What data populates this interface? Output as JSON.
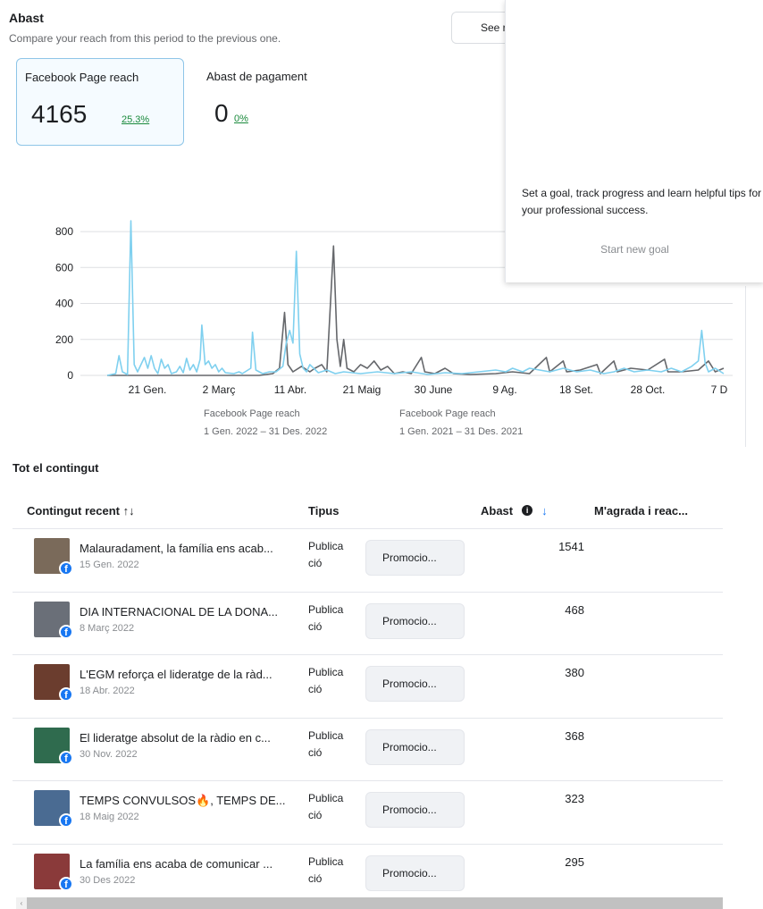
{
  "header": {
    "title": "Abast",
    "subtitle": "Compare your reach from this period to the previous one.",
    "see_more_label": "See r"
  },
  "metrics": [
    {
      "label": "Facebook Page reach",
      "value": "4165",
      "change": "25.3%"
    },
    {
      "label": "Abast de pagament",
      "value": "0",
      "change": "0%"
    }
  ],
  "goal_panel": {
    "text": "Set a goal, track progress and learn helpful tips for your professional success.",
    "button_label": "Start new goal"
  },
  "chart_data": {
    "type": "line",
    "x_tick_labels": [
      "21 Gen.",
      "2 Març",
      "11 Abr.",
      "21 Maig",
      "30 June",
      "9 Ag.",
      "18 Set.",
      "28 Oct.",
      "7 D"
    ],
    "y_tick_labels": [
      "0",
      "200",
      "400",
      "600",
      "800"
    ],
    "ylim": [
      0,
      860
    ],
    "x_range_days": [
      0,
      365
    ],
    "series": [
      {
        "name": "Facebook Page reach",
        "period": "1 Gen. 2022 – 31 Des. 2022",
        "color": "#7fd0ef",
        "points": [
          [
            0,
            0
          ],
          [
            5,
            10
          ],
          [
            7,
            110
          ],
          [
            9,
            20
          ],
          [
            12,
            5
          ],
          [
            14,
            860
          ],
          [
            16,
            60
          ],
          [
            18,
            20
          ],
          [
            20,
            60
          ],
          [
            22,
            100
          ],
          [
            24,
            40
          ],
          [
            26,
            110
          ],
          [
            28,
            40
          ],
          [
            30,
            10
          ],
          [
            32,
            90
          ],
          [
            34,
            40
          ],
          [
            36,
            60
          ],
          [
            38,
            10
          ],
          [
            41,
            20
          ],
          [
            43,
            50
          ],
          [
            45,
            15
          ],
          [
            47,
            95
          ],
          [
            49,
            30
          ],
          [
            51,
            60
          ],
          [
            53,
            20
          ],
          [
            55,
            90
          ],
          [
            56,
            280
          ],
          [
            58,
            60
          ],
          [
            60,
            80
          ],
          [
            62,
            40
          ],
          [
            64,
            60
          ],
          [
            66,
            20
          ],
          [
            68,
            40
          ],
          [
            70,
            15
          ],
          [
            75,
            10
          ],
          [
            78,
            20
          ],
          [
            80,
            10
          ],
          [
            85,
            40
          ],
          [
            86,
            240
          ],
          [
            88,
            30
          ],
          [
            92,
            10
          ],
          [
            96,
            20
          ],
          [
            100,
            20
          ],
          [
            104,
            50
          ],
          [
            106,
            180
          ],
          [
            108,
            250
          ],
          [
            110,
            180
          ],
          [
            112,
            690
          ],
          [
            114,
            120
          ],
          [
            116,
            40
          ],
          [
            118,
            20
          ],
          [
            120,
            60
          ],
          [
            125,
            15
          ],
          [
            130,
            30
          ],
          [
            135,
            10
          ],
          [
            140,
            20
          ],
          [
            150,
            10
          ],
          [
            160,
            20
          ],
          [
            170,
            10
          ],
          [
            180,
            20
          ],
          [
            190,
            5
          ],
          [
            200,
            15
          ],
          [
            210,
            10
          ],
          [
            220,
            20
          ],
          [
            230,
            30
          ],
          [
            236,
            20
          ],
          [
            240,
            40
          ],
          [
            246,
            20
          ],
          [
            250,
            40
          ],
          [
            256,
            30
          ],
          [
            262,
            20
          ],
          [
            270,
            40
          ],
          [
            278,
            20
          ],
          [
            286,
            30
          ],
          [
            294,
            10
          ],
          [
            300,
            20
          ],
          [
            306,
            40
          ],
          [
            312,
            20
          ],
          [
            320,
            30
          ],
          [
            328,
            20
          ],
          [
            334,
            40
          ],
          [
            340,
            20
          ],
          [
            346,
            50
          ],
          [
            350,
            80
          ],
          [
            352,
            250
          ],
          [
            354,
            70
          ],
          [
            356,
            20
          ],
          [
            360,
            40
          ],
          [
            365,
            10
          ]
        ]
      },
      {
        "name": "Facebook Page reach",
        "period": "1 Gen. 2021 – 31 Des. 2021",
        "color": "#65676b",
        "points": [
          [
            0,
            0
          ],
          [
            90,
            0
          ],
          [
            98,
            10
          ],
          [
            102,
            40
          ],
          [
            105,
            350
          ],
          [
            107,
            60
          ],
          [
            110,
            20
          ],
          [
            115,
            50
          ],
          [
            120,
            20
          ],
          [
            123,
            40
          ],
          [
            127,
            60
          ],
          [
            130,
            20
          ],
          [
            134,
            720
          ],
          [
            136,
            200
          ],
          [
            138,
            50
          ],
          [
            140,
            200
          ],
          [
            142,
            40
          ],
          [
            146,
            20
          ],
          [
            150,
            60
          ],
          [
            154,
            40
          ],
          [
            158,
            80
          ],
          [
            162,
            30
          ],
          [
            166,
            50
          ],
          [
            170,
            10
          ],
          [
            175,
            20
          ],
          [
            180,
            10
          ],
          [
            186,
            100
          ],
          [
            188,
            20
          ],
          [
            194,
            10
          ],
          [
            200,
            40
          ],
          [
            205,
            10
          ],
          [
            215,
            5
          ],
          [
            230,
            10
          ],
          [
            240,
            20
          ],
          [
            250,
            10
          ],
          [
            260,
            100
          ],
          [
            262,
            20
          ],
          [
            270,
            80
          ],
          [
            272,
            20
          ],
          [
            280,
            30
          ],
          [
            290,
            60
          ],
          [
            292,
            10
          ],
          [
            300,
            80
          ],
          [
            302,
            20
          ],
          [
            310,
            40
          ],
          [
            320,
            30
          ],
          [
            330,
            90
          ],
          [
            332,
            20
          ],
          [
            340,
            20
          ],
          [
            350,
            30
          ],
          [
            356,
            80
          ],
          [
            360,
            20
          ],
          [
            365,
            40
          ]
        ]
      }
    ]
  },
  "all_content": {
    "title": "Tot el contingut",
    "columns": [
      "Contingut recent ↑↓",
      "Tipus",
      "Abast",
      "M'agrada i reac..."
    ],
    "promote_label": "Promocio...",
    "rows": [
      {
        "title": "Malauradament, la família ens acab...",
        "date": "15 Gen. 2022",
        "type": "Publica ció",
        "reach": "1541"
      },
      {
        "title": "DIA INTERNACIONAL DE LA DONA...",
        "date": "8 Març 2022",
        "type": "Publica ció",
        "reach": "468"
      },
      {
        "title": "L'EGM reforça el lideratge de la ràd...",
        "date": "18 Abr. 2022",
        "type": "Publica ció",
        "reach": "380"
      },
      {
        "title": "El lideratge absolut de la ràdio en c...",
        "date": "30 Nov. 2022",
        "type": "Publica ció",
        "reach": "368"
      },
      {
        "title": "TEMPS CONVULSOS🔥, TEMPS DE...",
        "date": "18 Maig 2022",
        "type": "Publica ció",
        "reach": "323"
      },
      {
        "title": "La família ens acaba de comunicar ...",
        "date": "30 Des 2022",
        "type": "Publica ció",
        "reach": "295"
      }
    ]
  }
}
